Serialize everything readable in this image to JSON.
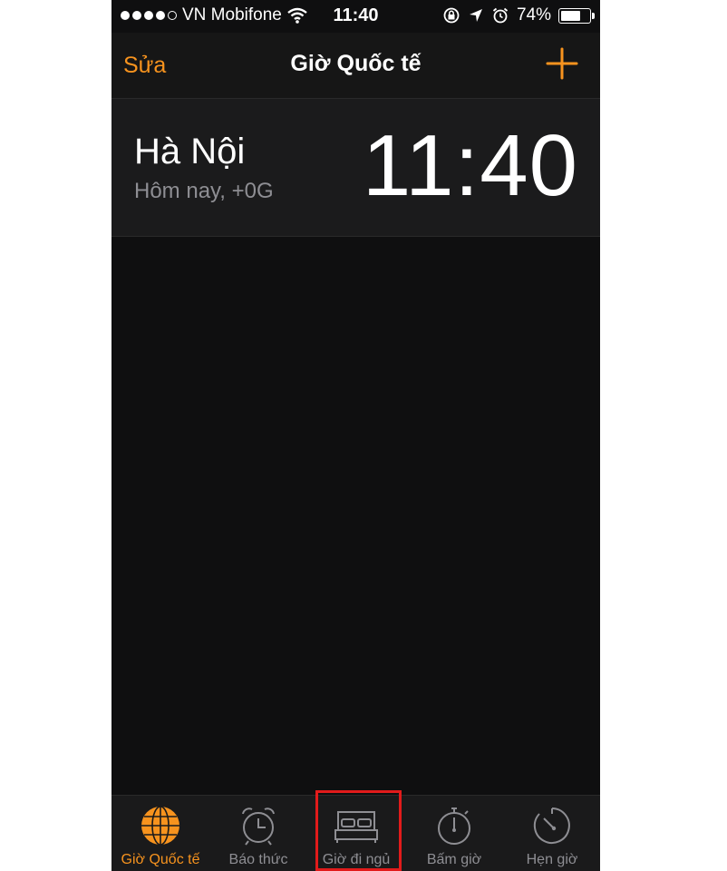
{
  "status_bar": {
    "carrier": "VN Mobifone",
    "time": "11:40",
    "battery": "74%",
    "battery_level": 0.74,
    "signal_dots_filled": 4
  },
  "nav": {
    "edit_label": "Sửa",
    "title": "Giờ Quốc tế",
    "add_icon": "plus-icon"
  },
  "clocks": [
    {
      "city": "Hà Nội",
      "offset": "Hôm nay, +0G",
      "time": "11:40"
    }
  ],
  "tabs": [
    {
      "label": "Giờ Quốc tế",
      "icon": "globe-icon",
      "active": true
    },
    {
      "label": "Báo thức",
      "icon": "alarm-clock-icon",
      "active": false
    },
    {
      "label": "Giờ đi ngủ",
      "icon": "bed-icon",
      "active": false
    },
    {
      "label": "Bấm giờ",
      "icon": "stopwatch-icon",
      "active": false
    },
    {
      "label": "Hẹn giờ",
      "icon": "timer-icon",
      "active": false
    }
  ],
  "colors": {
    "accent": "#f7931e",
    "background": "#0f0f10",
    "highlight": "#e21b1b"
  }
}
